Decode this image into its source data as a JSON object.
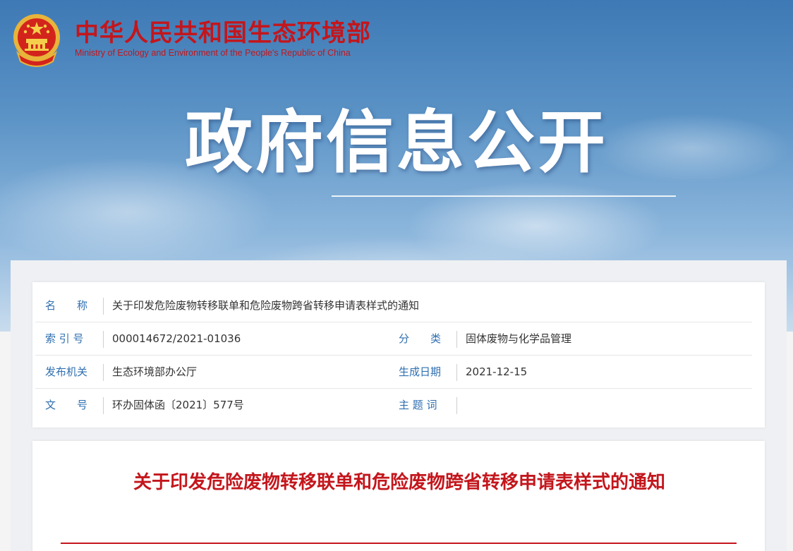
{
  "header": {
    "brand_cn": "中华人民共和国生态环境部",
    "brand_en": "Ministry of Ecology and Environment of the People's Republic of China",
    "hero_title": "政府信息公开"
  },
  "info": {
    "name_label": "名　　称",
    "name_value": "关于印发危险废物转移联单和危险废物跨省转移申请表样式的通知",
    "index_label": "索 引 号",
    "index_value": "000014672/2021-01036",
    "category_label": "分　　类",
    "category_value": "固体废物与化学品管理",
    "issuer_label": "发布机关",
    "issuer_value": "生态环境部办公厅",
    "date_label": "生成日期",
    "date_value": "2021-12-15",
    "docno_label": "文　　号",
    "docno_value": "环办固体函〔2021〕577号",
    "keywords_label": "主 题 词",
    "keywords_value": ""
  },
  "document": {
    "title": "关于印发危险废物转移联单和危险废物跨省转移申请表样式的通知"
  },
  "colors": {
    "brand_red": "#c3161c",
    "label_blue": "#2f6fb0"
  }
}
